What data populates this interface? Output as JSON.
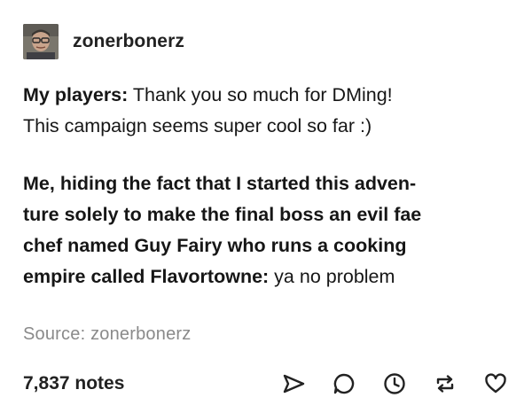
{
  "post": {
    "username": "zonerbonerz",
    "paragraph1": {
      "line1_bold": "My players:",
      "line1_rest": " Thank you so much for DMing!",
      "line2": "This campaign seems super cool so far :)"
    },
    "paragraph2": {
      "line1": "Me, hiding the fact that I started this adven-",
      "line2": "ture solely to make the final boss an evil fae",
      "line3": "chef named Guy Fairy who runs a cooking",
      "line4_bold": "empire called Flavortowne:",
      "line4_rest": " ya no problem"
    },
    "source": "Source: zonerbonerz"
  },
  "footer": {
    "notes": "7,837 notes",
    "icons": [
      "share-icon",
      "reply-icon",
      "history-icon",
      "reblog-icon",
      "like-icon"
    ]
  }
}
